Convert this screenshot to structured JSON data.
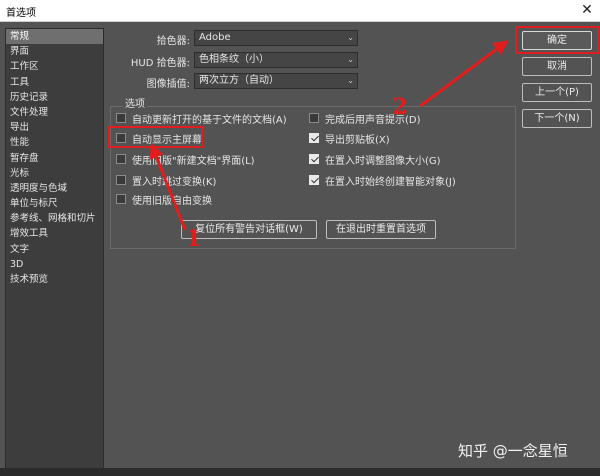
{
  "window": {
    "title": "首选项",
    "close_glyph": "✕"
  },
  "sidebar": {
    "items": [
      {
        "label": "常规",
        "active": true
      },
      {
        "label": "界面"
      },
      {
        "label": "工作区"
      },
      {
        "label": "工具"
      },
      {
        "label": "历史记录"
      },
      {
        "label": "文件处理"
      },
      {
        "label": "导出"
      },
      {
        "label": "性能"
      },
      {
        "label": "暂存盘"
      },
      {
        "label": "光标"
      },
      {
        "label": "透明度与色域"
      },
      {
        "label": "单位与标尺"
      },
      {
        "label": "参考线、网格和切片"
      },
      {
        "label": "增效工具"
      },
      {
        "label": "文字"
      },
      {
        "label": "3D"
      },
      {
        "label": "技术预览"
      }
    ]
  },
  "fields": {
    "color_picker": {
      "label": "拾色器:",
      "value": "Adobe"
    },
    "hud_picker": {
      "label": "HUD 拾色器:",
      "value": "色相条纹（小）"
    },
    "interpolation": {
      "label": "图像插值:",
      "value": "两次立方（自动）"
    }
  },
  "options": {
    "group_label": "选项",
    "left": [
      {
        "label": "自动更新打开的基于文件的文档(A)",
        "checked": false
      },
      {
        "label": "自动显示主屏幕",
        "checked": false
      },
      {
        "label": "使用旧版\"新建文档\"界面(L)",
        "checked": false
      },
      {
        "label": "置入时跳过变换(K)",
        "checked": false
      },
      {
        "label": "使用旧版自由变换",
        "checked": false
      }
    ],
    "right": [
      {
        "label": "完成后用声音提示(D)",
        "checked": false
      },
      {
        "label": "导出剪贴板(X)",
        "checked": true
      },
      {
        "label": "在置入时调整图像大小(G)",
        "checked": true
      },
      {
        "label": "在置入时始终创建智能对象(J)",
        "checked": true
      }
    ]
  },
  "buttons": {
    "reset_warnings": "复位所有警告对话框(W)",
    "reset_on_quit": "在退出时重置首选项",
    "ok": "确定",
    "cancel": "取消",
    "prev": "上一个(P)",
    "next": "下一个(N)"
  },
  "annotations": {
    "marker_1": "1",
    "marker_2": "2",
    "color": "#e11d1d"
  },
  "watermark": "知乎 @一念星恒"
}
